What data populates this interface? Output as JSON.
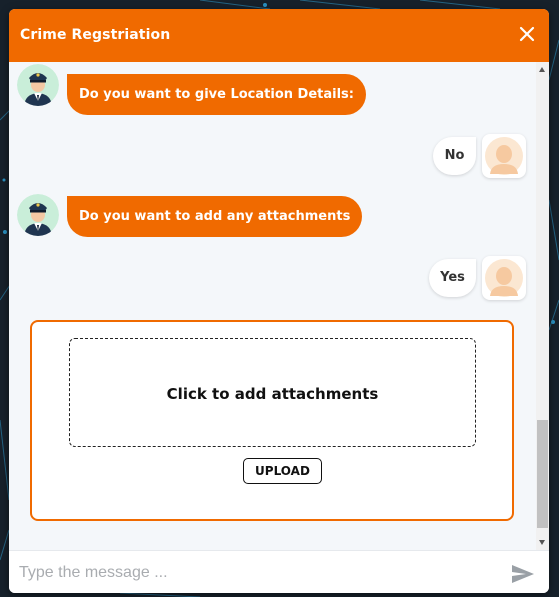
{
  "window": {
    "title": "Crime Regstriation",
    "close_icon": "close-icon"
  },
  "messages": [
    {
      "from": "bot",
      "text": "Do you want to give Location Details:",
      "avatar": "police-officer-icon"
    },
    {
      "from": "user",
      "text": "No",
      "avatar": "user-avatar-icon"
    },
    {
      "from": "bot",
      "text": "Do you want to add any attachments",
      "avatar": "police-officer-icon"
    },
    {
      "from": "user",
      "text": "Yes",
      "avatar": "user-avatar-icon"
    }
  ],
  "upload": {
    "dropzone_label": "Click to add attachments",
    "button_label": "UPLOAD"
  },
  "composer": {
    "placeholder": "Type the message ...",
    "send_icon": "send-icon"
  },
  "colors": {
    "accent": "#f06a00",
    "chat_bg": "#f4f7fa",
    "page_bg": "#17212b"
  }
}
